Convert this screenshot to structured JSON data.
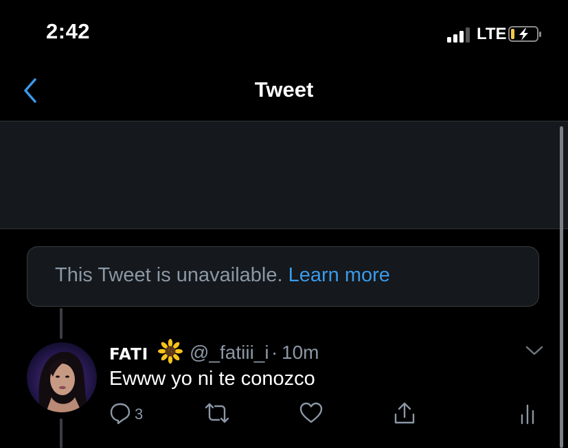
{
  "status_bar": {
    "time": "2:42",
    "network": "LTE",
    "signal_bars_filled": 3,
    "signal_bars_total": 4
  },
  "nav": {
    "title": "Tweet",
    "back_icon": "chevron-left-icon"
  },
  "unavailable": {
    "message": "This Tweet is unavailable.",
    "link_label": "Learn more"
  },
  "tweet": {
    "display_name": "FATI",
    "name_emoji_icon": "sunflower-icon",
    "handle": "@_fatiii_i",
    "separator": "·",
    "time": "10m",
    "text": "Ewww yo ni te conozco",
    "reply_count": "3"
  },
  "colors": {
    "background": "#000000",
    "banner": "#15181c",
    "accent": "#3a9ae9",
    "muted_text": "#8b98a5",
    "battery_low": "#f2c94c"
  }
}
